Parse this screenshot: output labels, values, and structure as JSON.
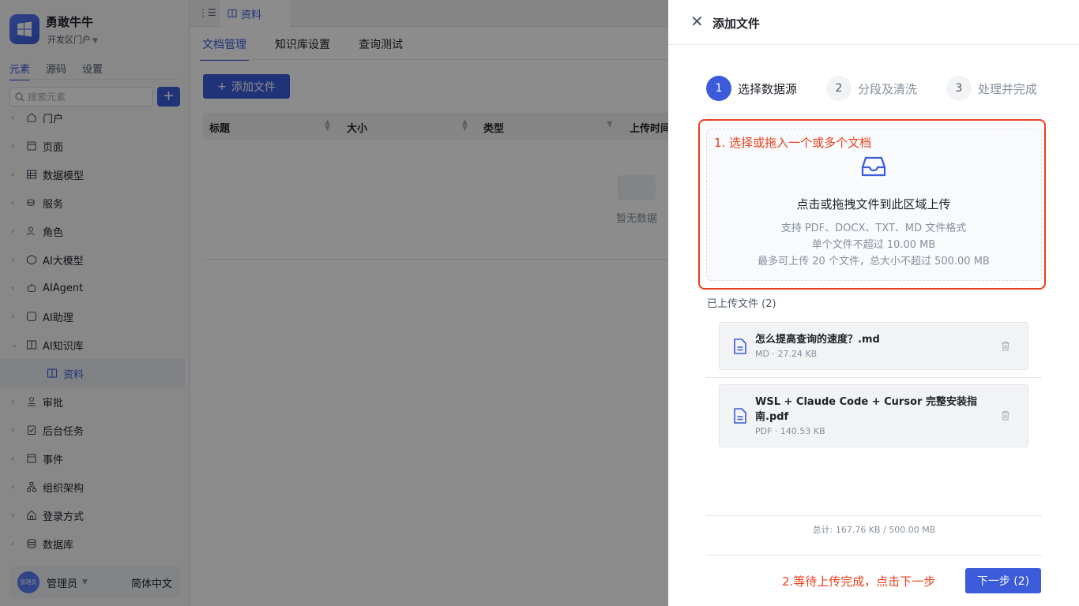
{
  "app": {
    "name": "勇敢牛牛",
    "portal": "开发区门户"
  },
  "sidebar": {
    "tabs": [
      "元素",
      "源码",
      "设置"
    ],
    "search_placeholder": "搜索元素",
    "add_label": "+",
    "items": [
      {
        "label": "门户",
        "icon": "home-icon"
      },
      {
        "label": "页面",
        "icon": "page-icon"
      },
      {
        "label": "数据模型",
        "icon": "table-icon"
      },
      {
        "label": "服务",
        "icon": "service-icon"
      },
      {
        "label": "角色",
        "icon": "role-icon"
      },
      {
        "label": "AI大模型",
        "icon": "cube-icon"
      },
      {
        "label": "AIAgent",
        "icon": "robot-icon"
      },
      {
        "label": "AI助理",
        "icon": "ai-icon"
      },
      {
        "label": "AI知识库",
        "icon": "book-icon"
      },
      {
        "label": "资料",
        "icon": "book-icon"
      },
      {
        "label": "审批",
        "icon": "stamp-icon"
      },
      {
        "label": "后台任务",
        "icon": "task-icon"
      },
      {
        "label": "事件",
        "icon": "event-icon"
      },
      {
        "label": "组织架构",
        "icon": "org-icon"
      },
      {
        "label": "登录方式",
        "icon": "login-icon"
      },
      {
        "label": "数据库",
        "icon": "database-icon"
      }
    ],
    "user": {
      "name": "管理员",
      "avatar_text": "管理员",
      "language": "简体中文"
    }
  },
  "main": {
    "tab": "资料",
    "sub_tabs": [
      "文档管理",
      "知识库设置",
      "查询测试"
    ],
    "add_file_label": "添加文件",
    "columns": [
      "标题",
      "大小",
      "类型",
      "上传时间"
    ],
    "empty_text": "暂无数据"
  },
  "drawer": {
    "title": "添加文件",
    "steps": [
      {
        "num": "1",
        "label": "选择数据源"
      },
      {
        "num": "2",
        "label": "分段及清洗"
      },
      {
        "num": "3",
        "label": "处理并完成"
      }
    ],
    "annotation_1": "1. 选择或拖入一个或多个文档",
    "upload": {
      "title": "点击或拖拽文件到此区域上传",
      "line1": "支持 PDF、DOCX、TXT、MD 文件格式",
      "line2": "单个文件不超过 10.00 MB",
      "line3": "最多可上传 20 个文件，总大小不超过 500.00 MB"
    },
    "uploaded_title": "已上传文件 (2)",
    "files": [
      {
        "name": "怎么提高查询的速度？.md",
        "meta": "MD · 27.24 KB"
      },
      {
        "name": "WSL + Claude Code + Cursor 完整安装指南.pdf",
        "meta": "PDF · 140.53 KB"
      }
    ],
    "total": "总计: 167.76 KB / 500.00 MB",
    "annotation_2": "2.等待上传完成，点击下一步",
    "next_label": "下一步 (2)"
  },
  "colors": {
    "accent": "#3b5bdb",
    "annotation": "#e8401e"
  }
}
